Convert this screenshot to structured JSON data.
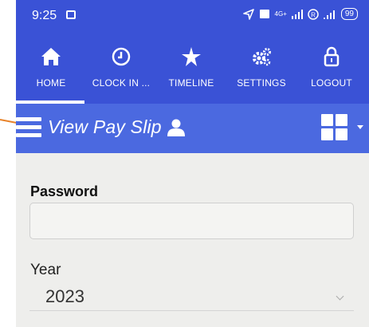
{
  "status_bar": {
    "time": "9:25",
    "network": "4G+",
    "battery": "99"
  },
  "nav": {
    "items": [
      {
        "label": "HOME",
        "icon": "home-icon",
        "active": true
      },
      {
        "label": "CLOCK IN ...",
        "icon": "clock-icon",
        "active": false
      },
      {
        "label": "TIMELINE",
        "icon": "sparkle-icon",
        "active": false
      },
      {
        "label": "SETTINGS",
        "icon": "gears-icon",
        "active": false
      },
      {
        "label": "LOGOUT",
        "icon": "lock-icon",
        "active": false
      }
    ]
  },
  "titlebar": {
    "title": "View Pay Slip"
  },
  "form": {
    "password_label": "Password",
    "password_value": "",
    "year_label": "Year",
    "year_value": "2023"
  },
  "colors": {
    "nav_bg": "#3a52d6",
    "titlebar_bg": "#4b69e0",
    "annotation_arrow": "#e8832a"
  }
}
